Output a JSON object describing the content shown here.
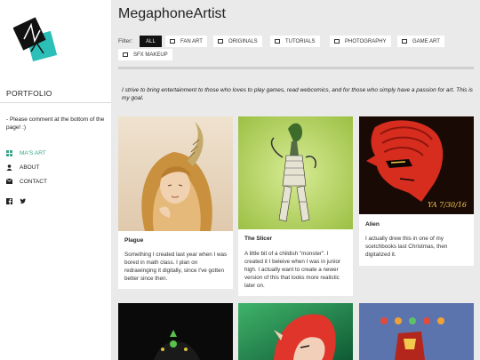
{
  "site": {
    "title": "MegaphoneArtist"
  },
  "sidebar": {
    "title": "PORTFOLIO",
    "note": "- Please comment at the bottom of the page! :)",
    "nav": [
      {
        "label": "MA'S ART",
        "icon": "grid-icon",
        "active": true
      },
      {
        "label": "ABOUT",
        "icon": "user-icon",
        "active": false
      },
      {
        "label": "CONTACT",
        "icon": "envelope-icon",
        "active": false
      }
    ],
    "social": [
      {
        "icon": "facebook-icon"
      },
      {
        "icon": "twitter-icon"
      }
    ]
  },
  "filter": {
    "label": "Filter:",
    "options": [
      {
        "label": "ALL",
        "active": true
      },
      {
        "label": "FAN ART",
        "active": false
      },
      {
        "label": "ORIGINALS",
        "active": false
      },
      {
        "label": "TUTORIALS",
        "active": false
      },
      {
        "label": "PHOTOGRAPHY",
        "active": false
      },
      {
        "label": "GAME ART",
        "active": false
      },
      {
        "label": "SFX MAKEUP",
        "active": false
      }
    ]
  },
  "intro": "I strive to bring entertainment to those who loves to play games, read webcomics, and for those who simply have a passion for art. This is my goal.",
  "cards": [
    {
      "title": "Plague",
      "description": "Something I created last year when I was bored in math class. I plan on redrawinging it digitally, since I've gotten better since then."
    },
    {
      "title": "The Slicer",
      "description": "A little bit of a childish \"monster\". I created it I beleive when I was in junior high. I actually want to create a newer version of this that looks more realistic later on."
    },
    {
      "title": "Alien",
      "description": "I actually drew this in one of my scetchbooks last Christmas, then digitalized it.",
      "signature": "YA 7/30/16"
    },
    {
      "title": "",
      "description": ""
    },
    {
      "title": "",
      "description": ""
    },
    {
      "title": "",
      "description": ""
    }
  ],
  "colors": {
    "accent": "#3aa58a",
    "logo_teal": "#2bbfb7",
    "page_bg": "#eaeaea"
  }
}
